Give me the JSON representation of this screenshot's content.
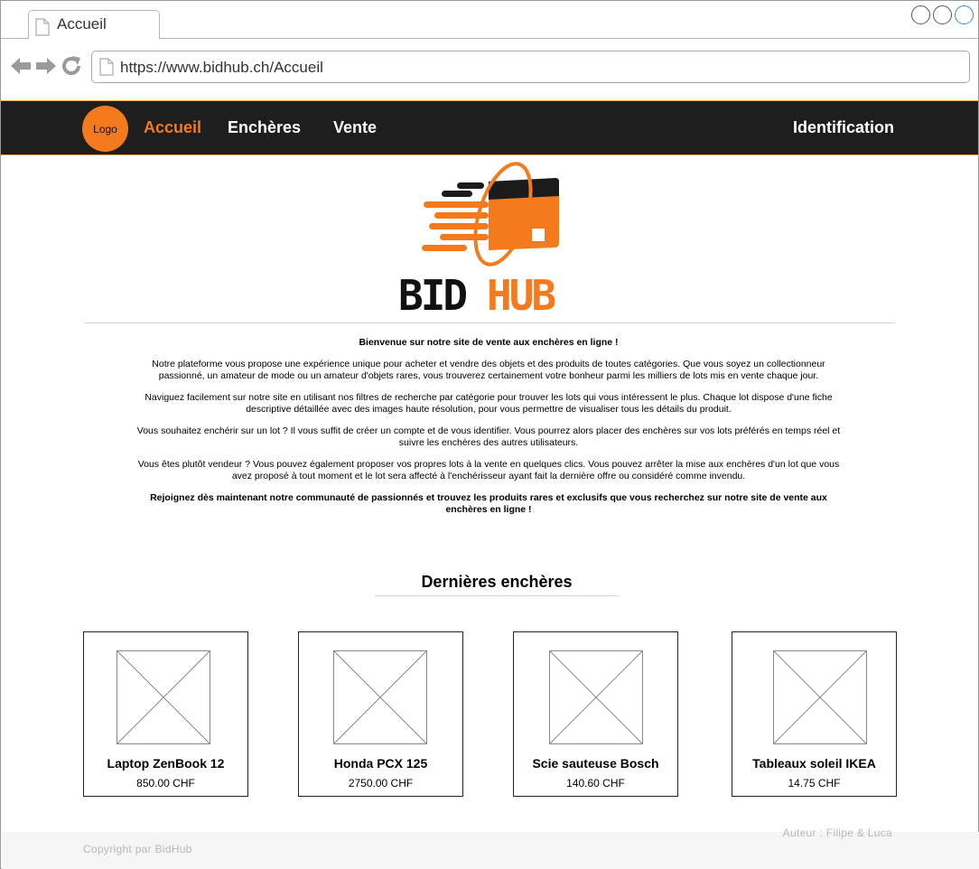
{
  "browser": {
    "tab_title": "Accueil",
    "url": "https://www.bidhub.ch/Accueil",
    "icons": [
      "back-arrow-icon",
      "forward-arrow-icon",
      "reload-icon",
      "document-icon"
    ]
  },
  "navbar": {
    "logo_label": "Logo",
    "links": [
      "Accueil",
      "Enchères",
      "Vente"
    ],
    "active": "Accueil",
    "login": "Identification"
  },
  "brand": {
    "wordmark": "BIDHUB",
    "colors": {
      "accent": "#f47a1d",
      "dark": "#1e1e1e"
    }
  },
  "intro": {
    "headline": "Bienvenue sur notre site de vente aux enchères en ligne !",
    "p1": "Notre plateforme vous propose une expérience unique pour acheter et vendre des objets et des produits de toutes catégories. Que vous soyez un collectionneur passionné, un amateur de mode ou un amateur d'objets rares, vous trouverez certainement votre bonheur parmi les milliers de lots mis en vente chaque jour.",
    "p2": "Naviguez facilement sur notre site en utilisant nos filtres de recherche par catégorie pour trouver les lots qui vous intéressent le plus. Chaque lot dispose d'une fiche descriptive détaillée avec des images haute résolution, pour vous permettre de visualiser tous les détails du produit.",
    "p3": "Vous souhaitez enchérir sur un lot ? Il vous suffit de créer un compte et de vous identifier. Vous pourrez alors placer des enchères sur vos lots préférés en temps réel et suivre les enchères des autres utilisateurs.",
    "p4": "Vous êtes plutôt vendeur ? Vous pouvez également proposer vos propres lots à la vente en quelques clics. Vous pouvez arrêter la mise aux enchères d'un lot que vous avez proposé à tout moment et le lot sera affecté à l'enchérisseur ayant fait la dernière offre ou considéré comme invendu.",
    "closing": "Rejoignez dès maintenant notre communauté de passionnés et trouvez les produits rares et exclusifs que vous recherchez sur notre site de vente aux enchères en ligne !"
  },
  "latest": {
    "title": "Dernières enchères",
    "items": [
      {
        "name": "Laptop ZenBook 12",
        "price": "850.00 CHF"
      },
      {
        "name": "Honda PCX 125",
        "price": "2750.00 CHF"
      },
      {
        "name": "Scie sauteuse Bosch",
        "price": "140.60 CHF"
      },
      {
        "name": "Tableaux soleil IKEA",
        "price": "14.75 CHF"
      }
    ]
  },
  "footer": {
    "copyright": "Copyright par BidHub",
    "author": "Auteur : Filipe & Luca"
  }
}
